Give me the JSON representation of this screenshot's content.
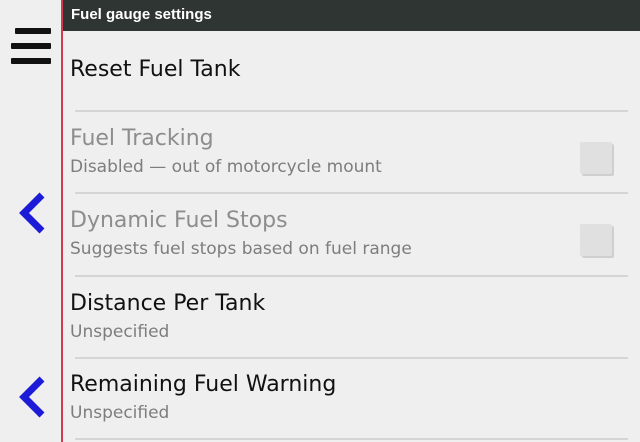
{
  "header": {
    "title": "Fuel gauge settings"
  },
  "left_rail": {
    "menu_icon": "hamburger-menu-icon",
    "back_icons": [
      "chevron-left-icon",
      "chevron-left-icon"
    ],
    "accent_color": "#1b1bd8",
    "divider_color": "#d23b4b"
  },
  "settings": {
    "reset": {
      "label": "Reset Fuel Tank"
    },
    "fuel_tracking": {
      "label": "Fuel Tracking",
      "summary": "Disabled — out of motorcycle mount",
      "checked": false,
      "enabled": false
    },
    "dynamic_fuel_stops": {
      "label": "Dynamic Fuel Stops",
      "summary": "Suggests fuel stops based on fuel range",
      "checked": false,
      "enabled": false
    },
    "distance_per_tank": {
      "label": "Distance Per Tank",
      "summary": "Unspecified"
    },
    "remaining_fuel_warning": {
      "label": "Remaining Fuel Warning",
      "summary": "Unspecified"
    }
  }
}
